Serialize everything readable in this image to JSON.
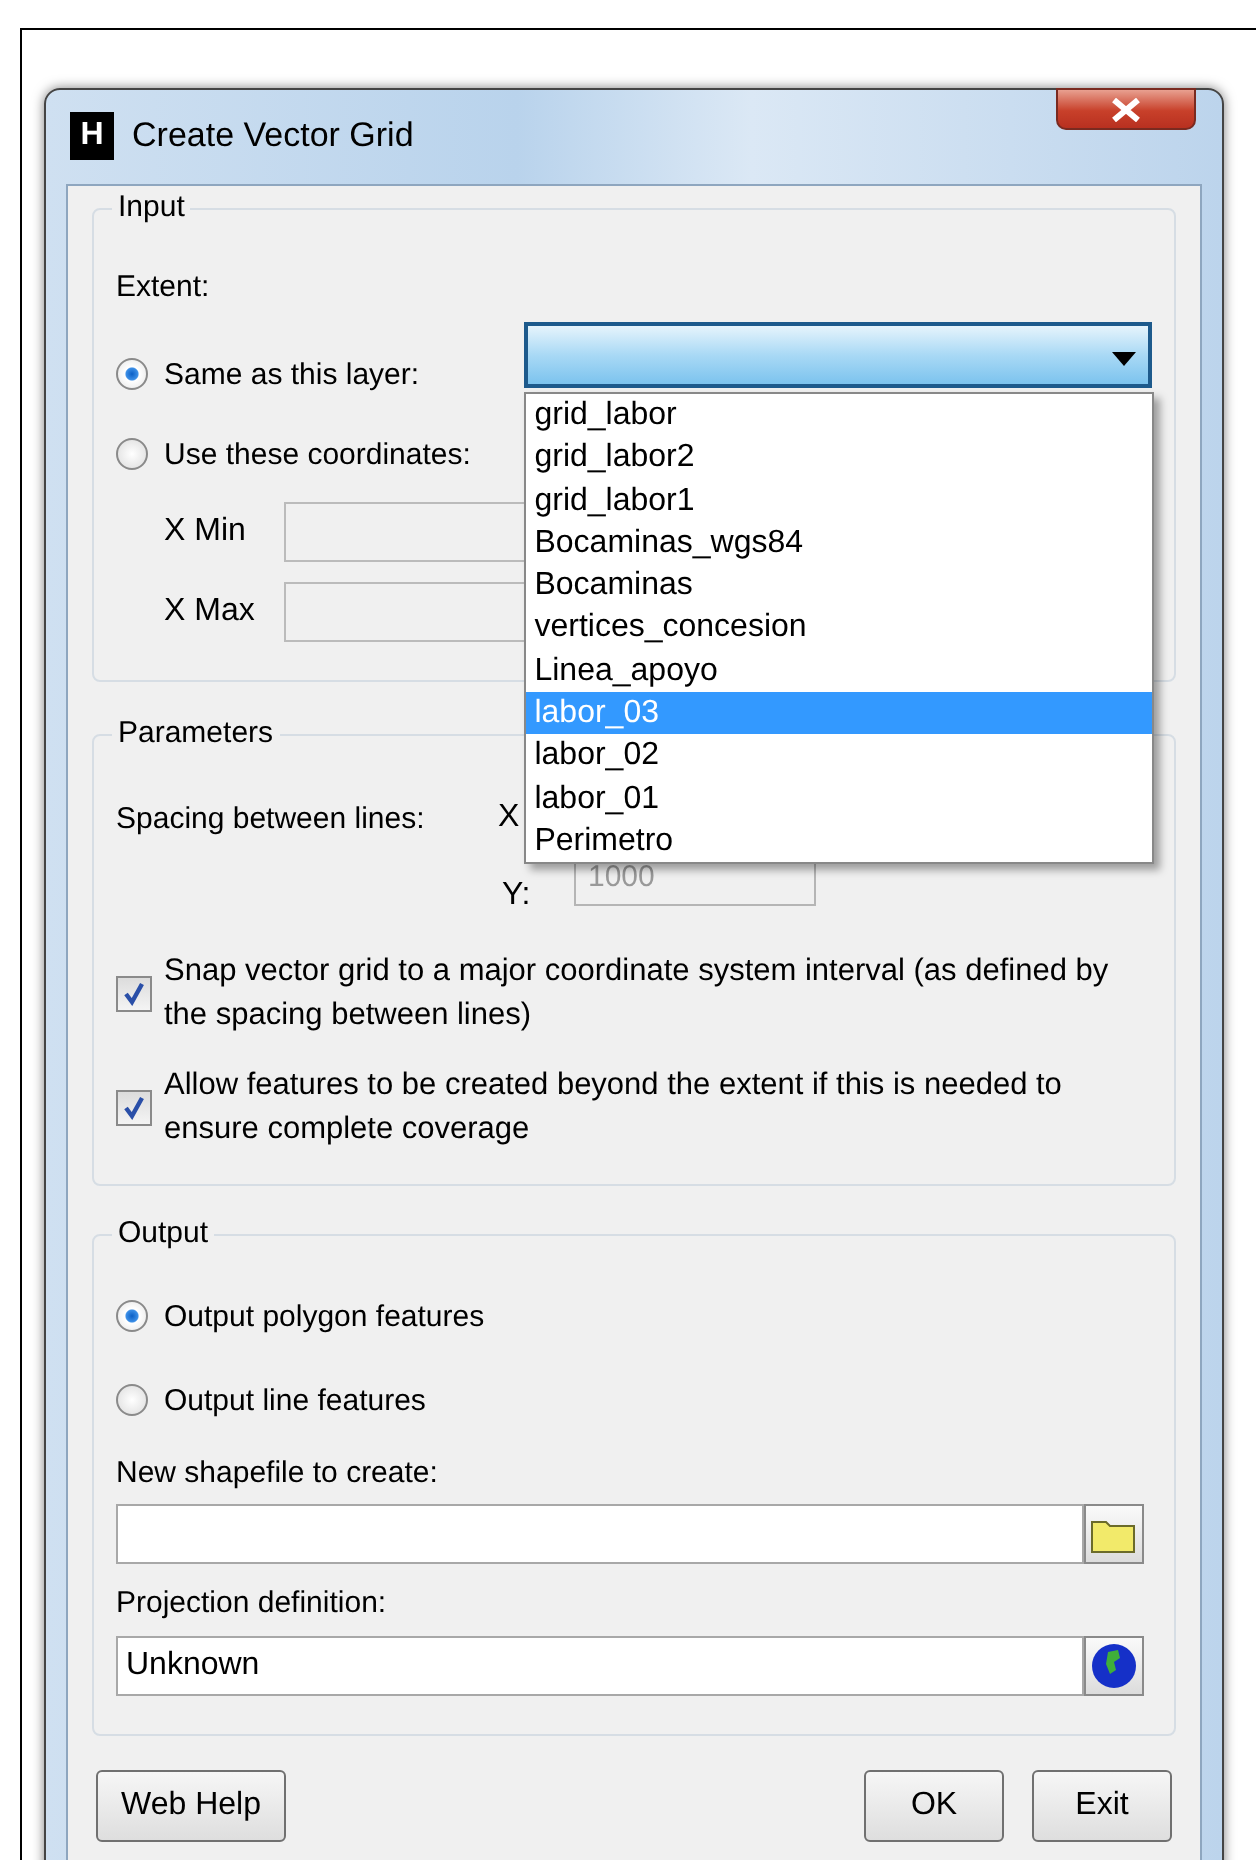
{
  "window": {
    "app_icon": "H",
    "title": "Create Vector Grid"
  },
  "input": {
    "legend": "Input",
    "extent_label": "Extent:",
    "options": [
      {
        "label": "Same as this layer:",
        "selected": true
      },
      {
        "label": "Use these coordinates:",
        "selected": false
      }
    ],
    "coords": [
      {
        "label": "X Min"
      },
      {
        "label": "X Max"
      }
    ],
    "layer_dropdown": {
      "expanded": true,
      "items": [
        {
          "label": "grid_labor",
          "selected": false
        },
        {
          "label": "grid_labor2",
          "selected": false
        },
        {
          "label": "grid_labor1",
          "selected": false
        },
        {
          "label": "Bocaminas_wgs84",
          "selected": false
        },
        {
          "label": "Bocaminas",
          "selected": false
        },
        {
          "label": "vertices_concesion",
          "selected": false
        },
        {
          "label": "Linea_apoyo",
          "selected": false
        },
        {
          "label": "labor_03",
          "selected": true
        },
        {
          "label": "labor_02",
          "selected": false
        },
        {
          "label": "labor_01",
          "selected": false
        },
        {
          "label": "Perimetro",
          "selected": false
        }
      ]
    }
  },
  "parameters": {
    "legend": "Parameters",
    "spacing_label": "Spacing between lines:",
    "x_label": "X",
    "y": {
      "label": "Y:",
      "value": "1000",
      "disabled": true
    },
    "checks": [
      {
        "label": "Snap vector grid to a major coordinate system interval (as defined by the spacing between lines)",
        "checked": true
      },
      {
        "label": "Allow features to be created beyond the extent if this is needed to ensure complete coverage",
        "checked": true
      }
    ]
  },
  "output": {
    "legend": "Output",
    "options": [
      {
        "label": "Output polygon features",
        "selected": true
      },
      {
        "label": "Output line features",
        "selected": false
      }
    ],
    "shapefile": {
      "label": "New shapefile to create:"
    },
    "projection": {
      "label": "Projection definition:",
      "value": "Unknown"
    }
  },
  "buttons": [
    {
      "label": "Web Help"
    },
    {
      "label": "OK"
    },
    {
      "label": "Exit"
    }
  ]
}
